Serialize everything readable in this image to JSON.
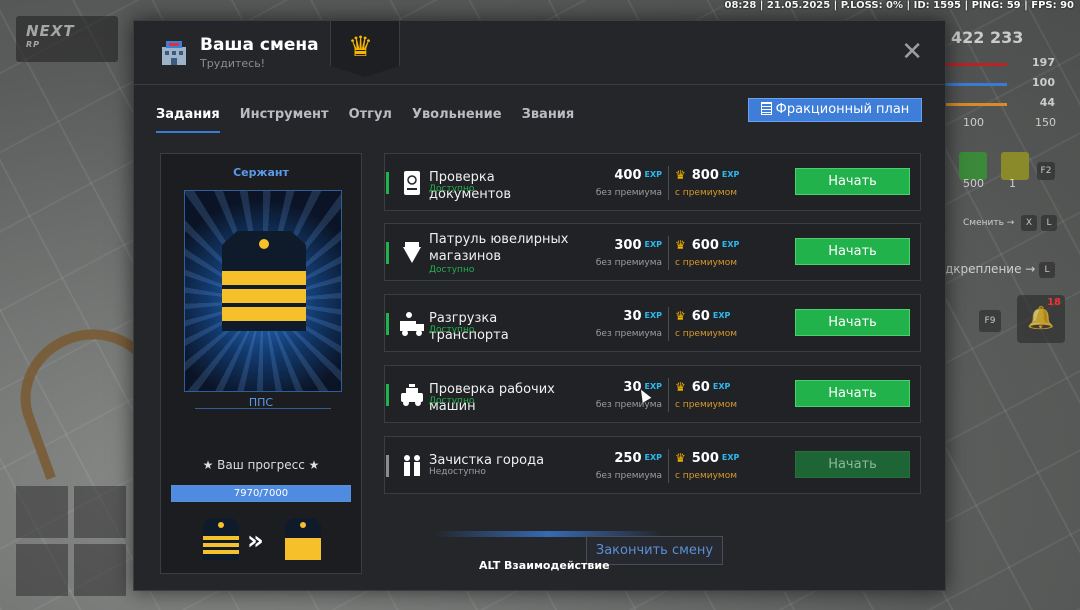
{
  "hud": {
    "status": "08:28 | 21.05.2025 | P.LOSS: 0% | ID: 1595 | PING: 59 | FPS: 90",
    "logo_top": "NEXT",
    "logo_bottom": "RP",
    "money": "422 233",
    "health": "197",
    "hunger": "100",
    "armor": "44",
    "stat_a": "100",
    "stat_b": "150",
    "slot_a": "500",
    "slot_b": "1",
    "key_f2": "F2",
    "change_label": "Сменить →",
    "key_x": "X",
    "key_l": "L",
    "attach_label": "дкрепление →",
    "key_l2": "L",
    "key_f9": "F9",
    "notifications": "18"
  },
  "dialog": {
    "title": "Ваша смена",
    "subtitle": "Трудитесь!",
    "tabs": [
      "Задания",
      "Инструмент",
      "Отгул",
      "Увольнение",
      "Звания"
    ],
    "active_tab": 0,
    "plan_button": "Фракционный план",
    "finish_button": "Закончить смену",
    "alt_hint": "ALT Взаимодействие"
  },
  "rank": {
    "name": "Сержант",
    "unit": "ППС",
    "progress_label": "★ Ваш прогресс ★",
    "progress_text": "7970/7000",
    "progress_fraction": 1.0
  },
  "tasks": [
    {
      "name": "Проверка документов",
      "state": "Доступно",
      "exp": "400",
      "exp_premium": "800",
      "enabled": true,
      "icon": "passport-icon"
    },
    {
      "name": "Патруль ювелирных магазинов",
      "state": "Доступно",
      "exp": "300",
      "exp_premium": "600",
      "enabled": true,
      "icon": "diamond-icon"
    },
    {
      "name": "Разгрузка транспорта",
      "state": "Доступно",
      "exp": "30",
      "exp_premium": "60",
      "enabled": true,
      "icon": "truck-icon"
    },
    {
      "name": "Проверка рабочих машин",
      "state": "Доступно",
      "exp": "30",
      "exp_premium": "60",
      "enabled": true,
      "icon": "police-car-icon"
    },
    {
      "name": "Зачистка города",
      "state": "Недоступно",
      "exp": "250",
      "exp_premium": "500",
      "enabled": false,
      "icon": "people-icon"
    }
  ],
  "labels": {
    "exp": "EXP",
    "no_premium": "без премиума",
    "with_premium": "с премиумом",
    "start": "Начать"
  },
  "colors": {
    "accent": "#3f7ed8",
    "start_green": "#22b24c",
    "crown_gold": "#f7b500",
    "exp_blue": "#2fb9f0"
  }
}
